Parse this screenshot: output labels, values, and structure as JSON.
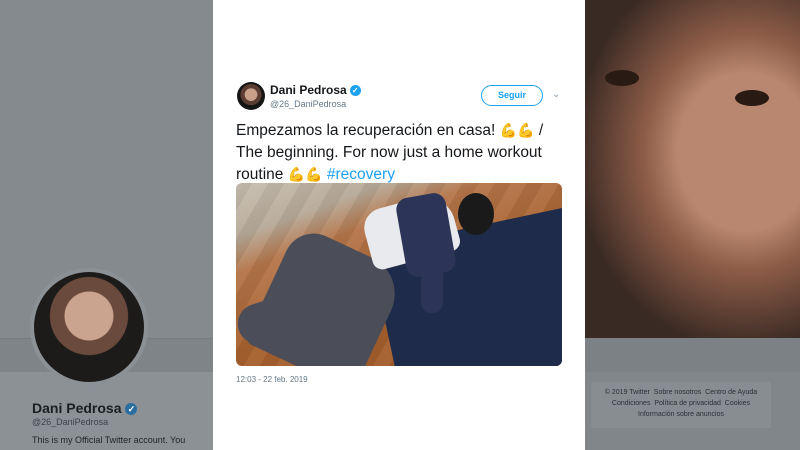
{
  "background": {
    "profile_name": "Dani Pedrosa",
    "profile_handle": "@26_DaniPedrosa",
    "profile_bio": "This is my Official Twitter account. You can",
    "footer_links": [
      "© 2019 Twitter",
      "Sobre nosotros",
      "Centro de Ayuda",
      "Condiciones",
      "Política de privacidad",
      "Cookies",
      "Información sobre anuncios"
    ]
  },
  "tweet": {
    "author_name": "Dani Pedrosa",
    "author_handle": "@26_DaniPedrosa",
    "follow_label": "Seguir",
    "text_part1": "Empezamos la recuperación en casa! ",
    "emoji_1": "💪💪",
    "text_part2": " / The beginning. For now just a home workout routine ",
    "emoji_2": "💪💪",
    "hashtag": "#recovery",
    "timestamp": "12:03 - 22 feb. 2019"
  },
  "icons": {
    "verified": "verified-badge-icon",
    "more": "chevron-down-icon"
  },
  "colors": {
    "accent": "#1da1f2",
    "text": "#14171a",
    "muted": "#657786"
  }
}
